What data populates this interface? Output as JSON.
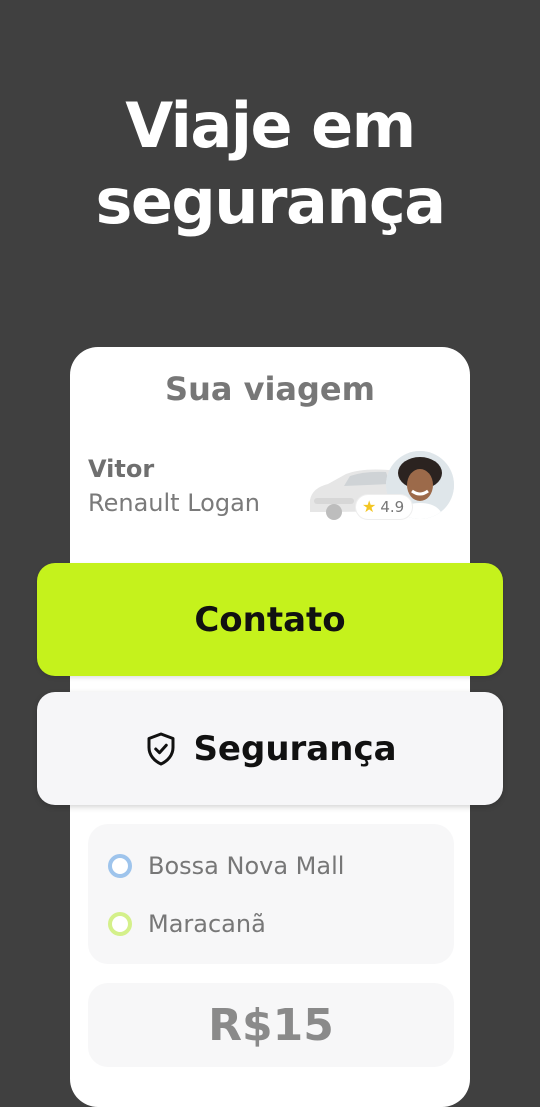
{
  "headline": {
    "line1": "Viaje em",
    "line2": "segurança"
  },
  "card": {
    "title": "Sua viagem",
    "driver": {
      "name": "Vitor",
      "car": "Renault Logan",
      "rating": "4.9"
    }
  },
  "buttons": {
    "contact": "Contato",
    "security": "Segurança"
  },
  "route": {
    "origin": "Bossa Nova Mall",
    "destination": "Maracanã"
  },
  "price": "R$15",
  "colors": {
    "background": "#404040",
    "accent": "#c5f21c",
    "origin_dot": "#9ec4ec",
    "destination_dot": "#d4f08a"
  },
  "icons": {
    "security": "shield-check-icon",
    "rating": "star-icon"
  }
}
